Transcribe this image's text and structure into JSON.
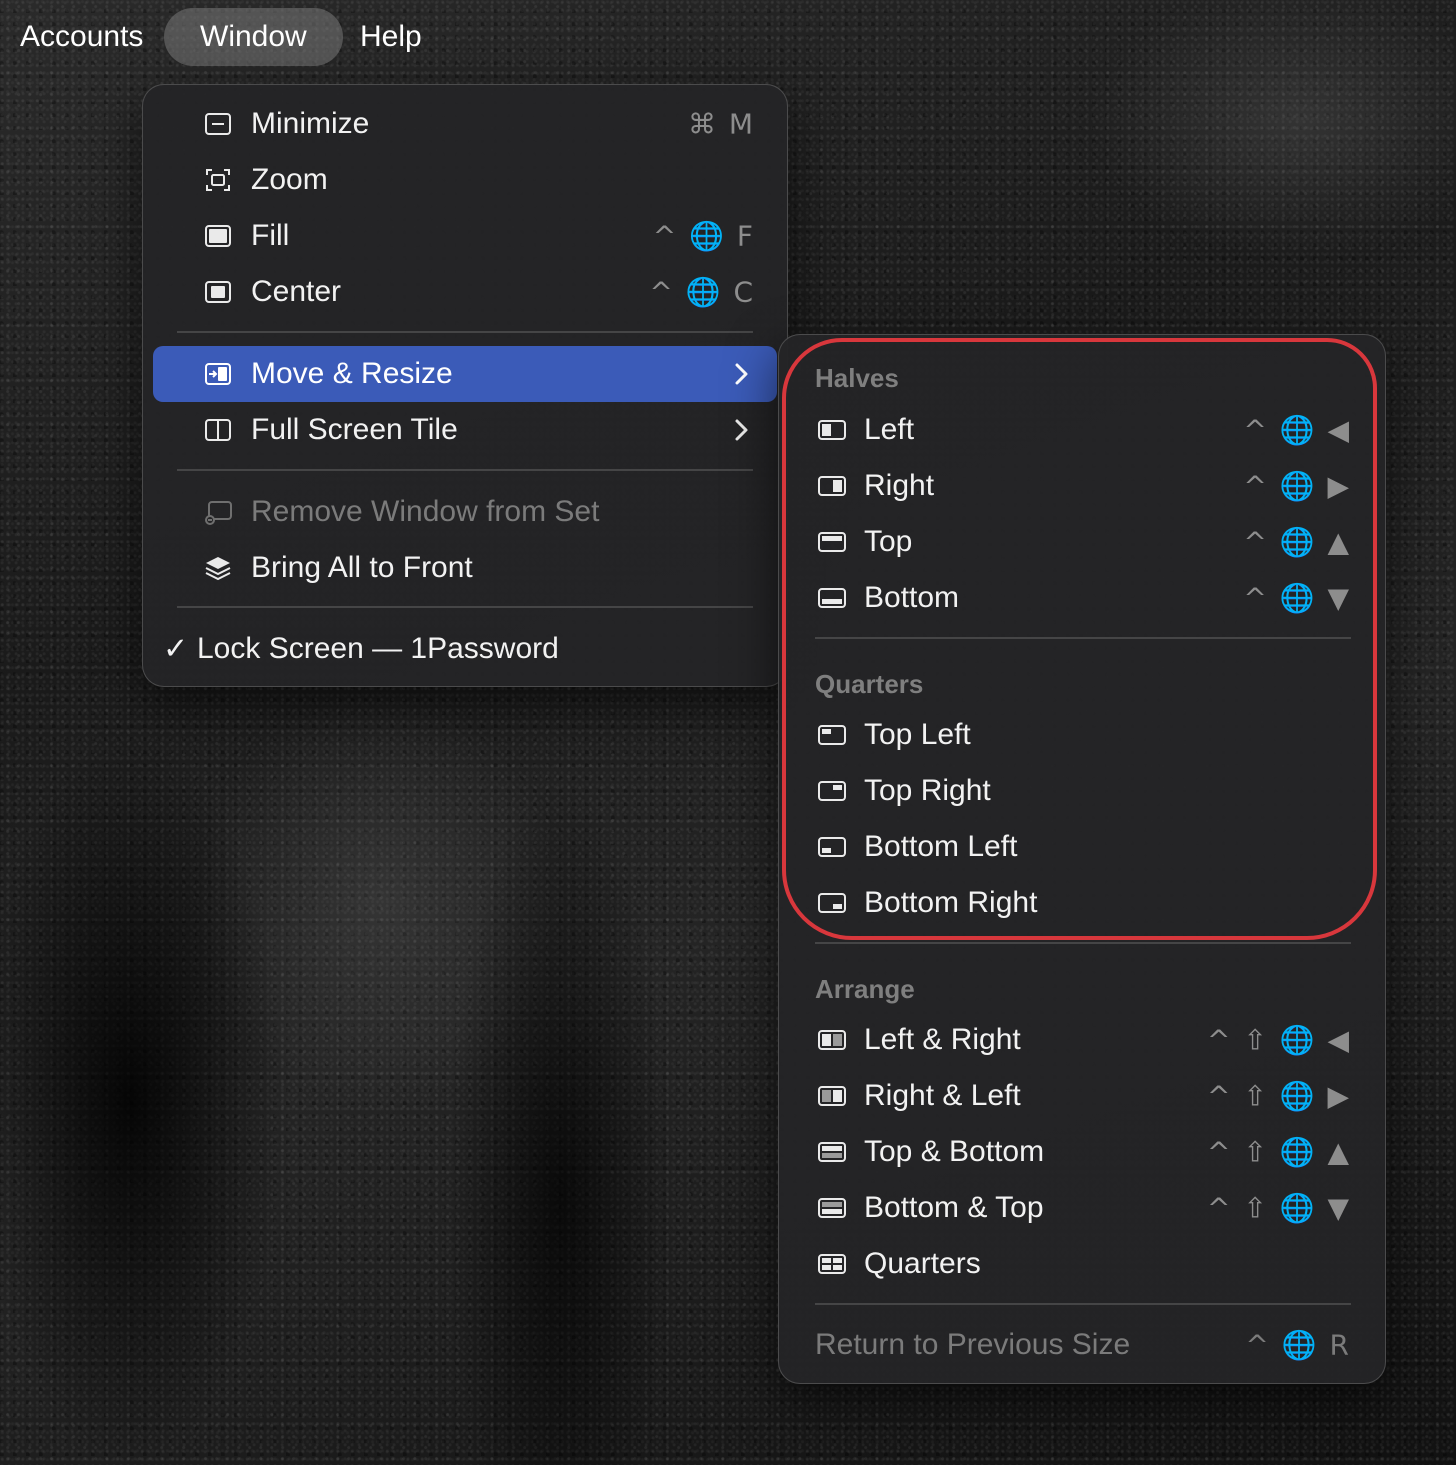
{
  "menubar": {
    "items": [
      "Accounts",
      "Window",
      "Help"
    ]
  },
  "window_menu": {
    "items": [
      {
        "label": "Minimize",
        "shortcut": "⌘ M",
        "icon": "minimize-window-icon"
      },
      {
        "label": "Zoom",
        "shortcut": "",
        "icon": "zoom-window-icon"
      },
      {
        "label": "Fill",
        "shortcut": "^ 🌐 F",
        "icon": "fill-window-icon"
      },
      {
        "label": "Center",
        "shortcut": "^ 🌐 C",
        "icon": "center-window-icon"
      },
      {
        "label": "Move & Resize",
        "shortcut": "",
        "icon": "move-resize-icon",
        "submenu": true,
        "highlighted": true
      },
      {
        "label": "Full Screen Tile",
        "shortcut": "",
        "icon": "full-screen-tile-icon",
        "submenu": true
      },
      {
        "label": "Remove Window from Set",
        "shortcut": "",
        "icon": "remove-window-icon",
        "disabled": true
      },
      {
        "label": "Bring All to Front",
        "shortcut": "",
        "icon": "stack-icon"
      },
      {
        "label": "Lock Screen — 1Password",
        "checkmark": "✓"
      }
    ]
  },
  "move_resize_submenu": {
    "halves_header": "Halves",
    "halves": [
      {
        "label": "Left",
        "shortcut": "^ 🌐 ◀"
      },
      {
        "label": "Right",
        "shortcut": "^ 🌐 ▶"
      },
      {
        "label": "Top",
        "shortcut": "^ 🌐 ▲"
      },
      {
        "label": "Bottom",
        "shortcut": "^ 🌐 ▼"
      }
    ],
    "quarters_header": "Quarters",
    "quarters": [
      {
        "label": "Top Left"
      },
      {
        "label": "Top Right"
      },
      {
        "label": "Bottom Left"
      },
      {
        "label": "Bottom Right"
      }
    ],
    "arrange_header": "Arrange",
    "arrange": [
      {
        "label": "Left & Right",
        "shortcut": "^ ⇧ 🌐 ◀"
      },
      {
        "label": "Right & Left",
        "shortcut": "^ ⇧ 🌐 ▶"
      },
      {
        "label": "Top & Bottom",
        "shortcut": "^ ⇧ 🌐 ▲"
      },
      {
        "label": "Bottom & Top",
        "shortcut": "^ ⇧ 🌐 ▼"
      },
      {
        "label": "Quarters",
        "shortcut": ""
      }
    ],
    "return": {
      "label": "Return to Previous Size",
      "shortcut": "^ 🌐 R",
      "disabled": true
    }
  },
  "colors": {
    "highlight": "#3b5bb8",
    "annotation": "#d8373c",
    "menu_bg": "#242426"
  }
}
